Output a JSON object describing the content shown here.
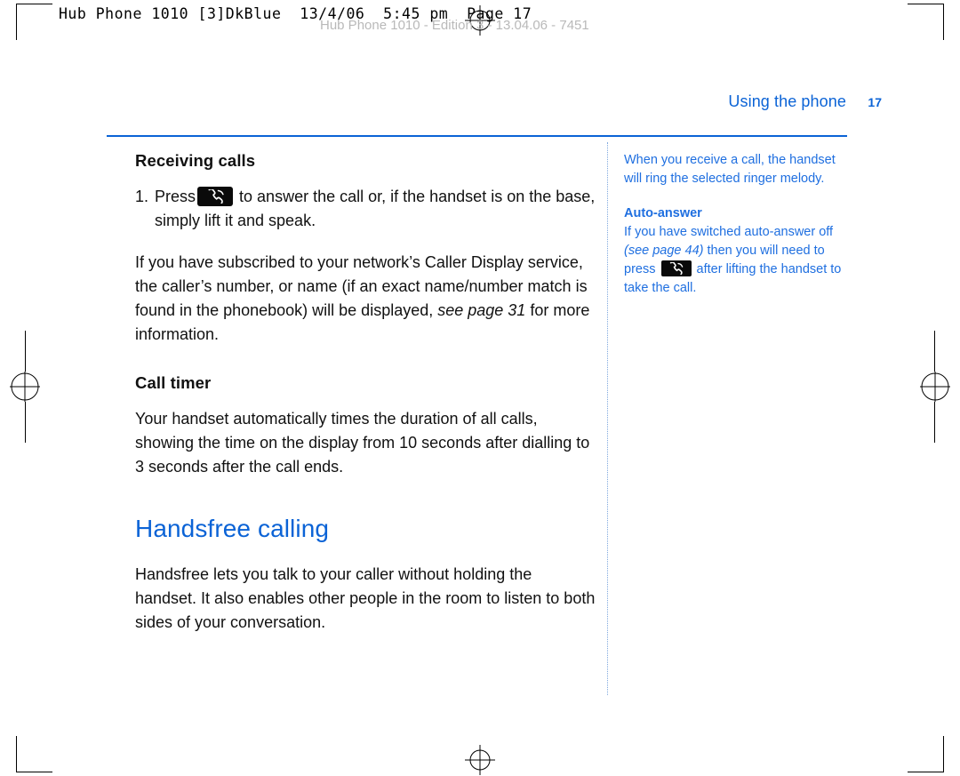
{
  "slug": {
    "mono_line": "Hub Phone 1010 [3]DkBlue  13/4/06  5:45 pm  Page 17",
    "faint_line": "Hub Phone 1010 - Edition 3 - 13.04.06 - 7451"
  },
  "header": {
    "running_head": "Using the phone",
    "page_number": "17"
  },
  "main": {
    "section_title": "Receiving calls",
    "step1": {
      "number": "1.",
      "before_key": "Press",
      "after_key": "to answer the call or, if the handset is on the base, simply lift it and speak."
    },
    "paragraph_caller_display": {
      "part1": "If you have subscribed to your network’s Caller Display service, the caller’s number, or name (if an exact name/number match is found in the phonebook) will be displayed, ",
      "italic": "see page 31",
      "part2": " for more information."
    },
    "call_timer_title": "Call timer",
    "call_timer_body": "Your handset automatically times the duration of all calls, showing the time on the display from 10 seconds after dialling to 3 seconds after the call ends.",
    "chapter_title": "Handsfree calling",
    "handsfree_body": "Handsfree lets you talk to your caller without holding the handset. It also enables other people in the room to listen to both sides of your conversation."
  },
  "sidebar": {
    "note1": "When you receive a call, the handset will ring the selected ringer melody.",
    "auto_answer_title": "Auto-answer",
    "auto_answer": {
      "part1": "If you have switched auto-answer off ",
      "italic": "(see page 44)",
      "part2": " then you will need to press ",
      "part3": " after lifting the handset to take the call."
    }
  },
  "icons": {
    "handset_key": "telephone-handset-icon"
  },
  "colors": {
    "accent": "#0b63d6",
    "sidebar_text": "#1f6fe0",
    "body_text": "#111111",
    "key_background": "#0a0a0a"
  }
}
